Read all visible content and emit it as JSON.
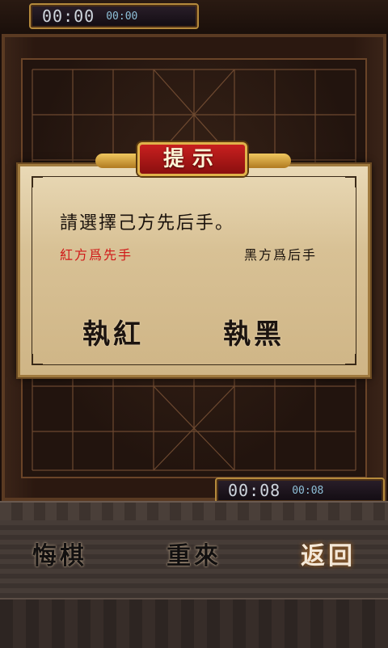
{
  "timers": {
    "top": {
      "main": "00:00",
      "sub": "00:00"
    },
    "bottom": {
      "main": "00:08",
      "sub": "00:08"
    }
  },
  "dialog": {
    "title": "提示",
    "prompt": "請選擇己方先后手。",
    "option_red": "紅方爲先手",
    "option_black": "黑方爲后手",
    "choose_red": "執紅",
    "choose_black": "執黑"
  },
  "toolbar": {
    "undo": "悔棋",
    "restart": "重來",
    "back": "返回"
  },
  "colors": {
    "title_red": "#b81818",
    "option_red": "#d01818",
    "frame_gold": "#b58a3c"
  }
}
